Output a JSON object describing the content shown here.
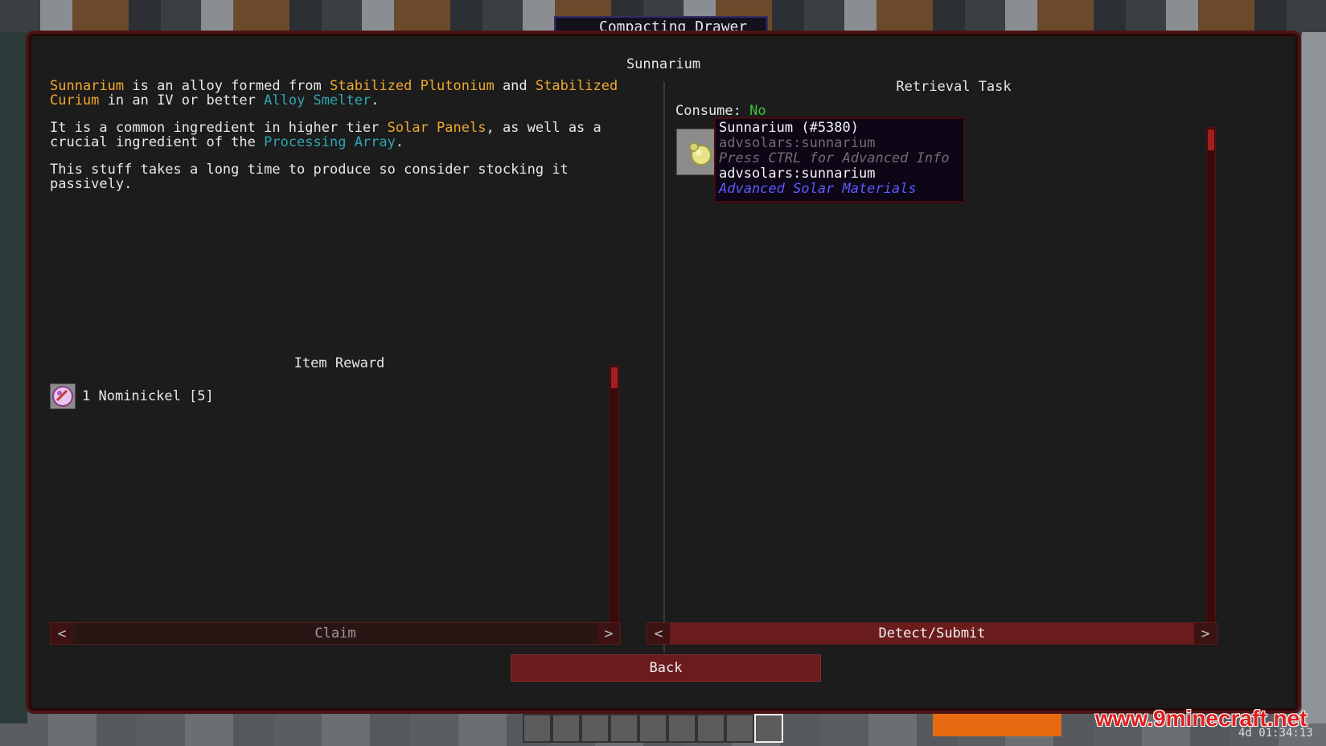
{
  "window": {
    "top_label": "Compacting Drawer",
    "title": "Sunnarium"
  },
  "description": {
    "p1": [
      {
        "text": "Sunnarium",
        "style": "orange"
      },
      {
        "text": " is an alloy formed from ",
        "style": "plain"
      },
      {
        "text": "Stabilized Plutonium",
        "style": "orange"
      },
      {
        "text": " and ",
        "style": "plain"
      },
      {
        "text": "Stabilized Curium",
        "style": "orange"
      },
      {
        "text": " in an IV or better ",
        "style": "plain"
      },
      {
        "text": "Alloy Smelter",
        "style": "teal"
      },
      {
        "text": ".",
        "style": "plain"
      }
    ],
    "p2": [
      {
        "text": "It is a common ingredient in higher tier ",
        "style": "plain"
      },
      {
        "text": "Solar Panels",
        "style": "orange"
      },
      {
        "text": ", as well as a crucial ingredient of the ",
        "style": "plain"
      },
      {
        "text": "Processing Array",
        "style": "teal"
      },
      {
        "text": ".",
        "style": "plain"
      }
    ],
    "p3": "This stuff takes a long time to produce so consider stocking it passively."
  },
  "reward": {
    "title": "Item Reward",
    "item_label": "1 Nominickel [5]",
    "icon": "nominickel-coin-icon"
  },
  "buttons": {
    "claim": "Claim",
    "detect_submit": "Detect/Submit",
    "back": "Back",
    "prev_arrow": "<",
    "next_arrow": ">"
  },
  "task": {
    "title": "Retrieval Task",
    "consume_label": "Consume: ",
    "consume_value": "No",
    "icon": "sunnarium-item-icon"
  },
  "tooltip": {
    "line1": "Sunnarium (#5380)",
    "line2": "advsolars:sunnarium",
    "line3": "Press CTRL for Advanced Info",
    "line4": "advsolars:sunnarium",
    "line5": "Advanced Solar Materials"
  },
  "overlay": {
    "watermark": "www.9minecraft.net",
    "clock": "4d 01:34:13"
  },
  "colors": {
    "orange": "#f0a830",
    "teal": "#2fa6b3",
    "green": "#3ec43e",
    "frame": "#4a1414"
  }
}
